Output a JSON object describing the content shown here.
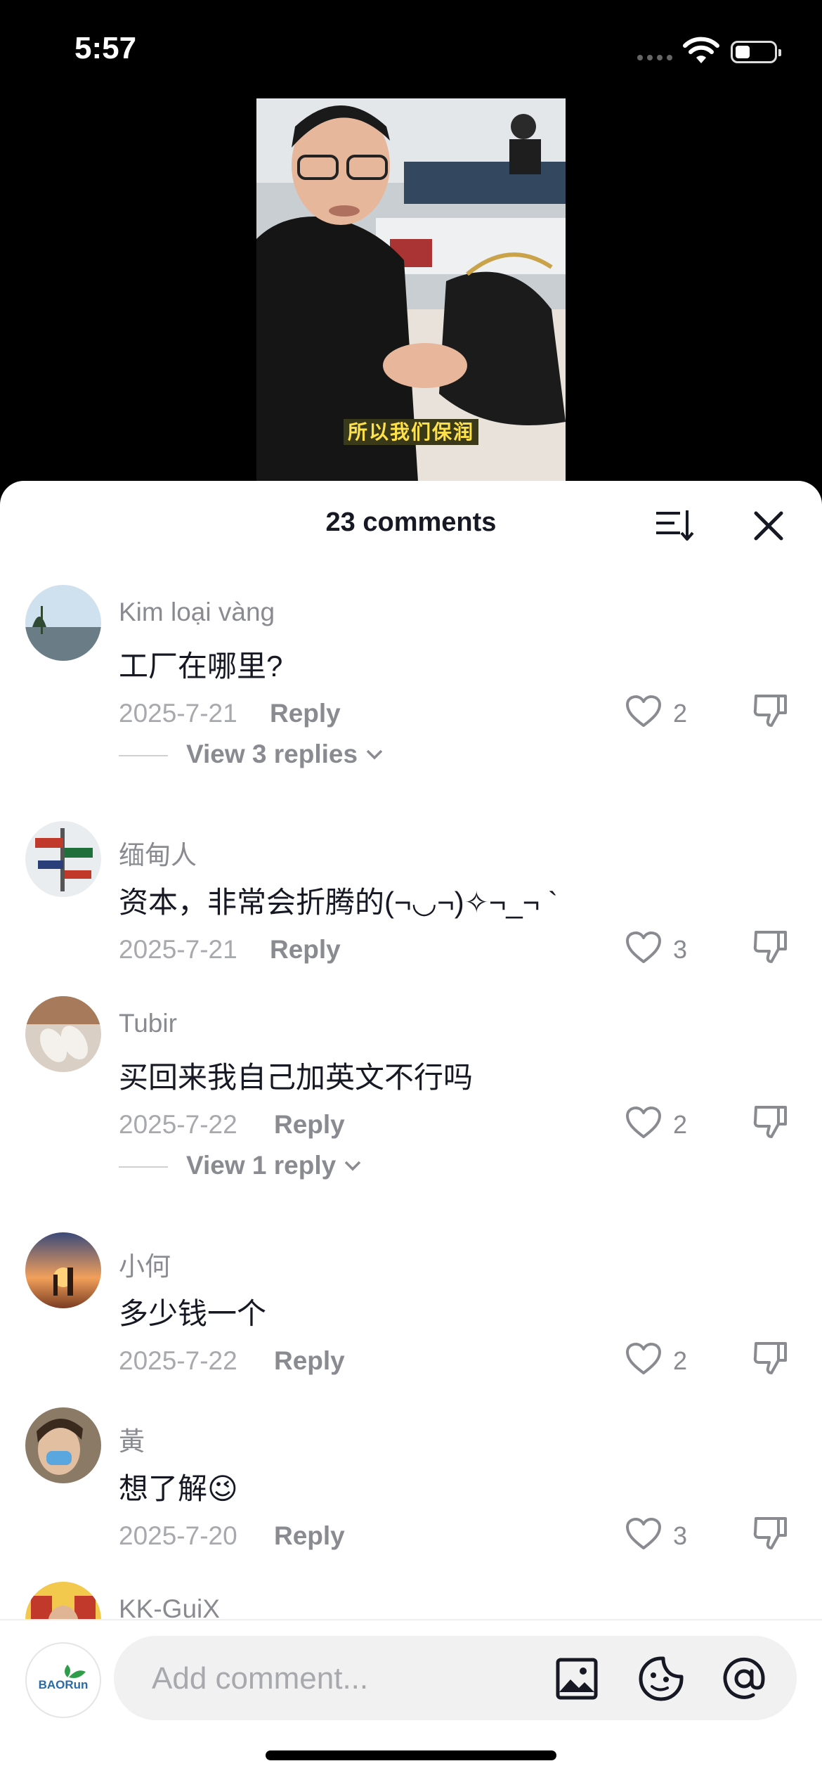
{
  "status_bar": {
    "time": "5:57"
  },
  "video": {
    "subtitle": "所以我们保润"
  },
  "sheet": {
    "title": "23 comments"
  },
  "comments": [
    {
      "username": "Kim loại vàng",
      "text": "工厂在哪里?",
      "date": "2025-7-21",
      "reply_label": "Reply",
      "likes": "2",
      "view_replies": "View 3 replies"
    },
    {
      "username": "缅甸人",
      "text": "资本，非常会折腾的(¬◡¬)✧¬_¬ `",
      "date": "2025-7-21",
      "reply_label": "Reply",
      "likes": "3"
    },
    {
      "username": "Tubir",
      "text": "买回来我自己加英文不行吗",
      "date": "2025-7-22",
      "reply_label": "Reply",
      "likes": "2",
      "view_replies": "View 1 reply"
    },
    {
      "username": "小何",
      "text": "多少钱一个",
      "date": "2025-7-22",
      "reply_label": "Reply",
      "likes": "2"
    },
    {
      "username": "黃",
      "text": "想了解😉",
      "date": "2025-7-20",
      "reply_label": "Reply",
      "likes": "3"
    },
    {
      "username": "KK-GuiX"
    }
  ],
  "comment_bar": {
    "placeholder": "Add comment...",
    "logo_text": "BAORun"
  },
  "colors": {
    "text_primary": "#161823",
    "text_secondary": "#8a8b91",
    "input_bg": "#f1f1f2"
  },
  "icons": [
    "sort-icon",
    "close-icon",
    "heart-icon",
    "dislike-icon",
    "chevron-down-icon",
    "image-icon",
    "sticker-icon",
    "mention-icon"
  ]
}
